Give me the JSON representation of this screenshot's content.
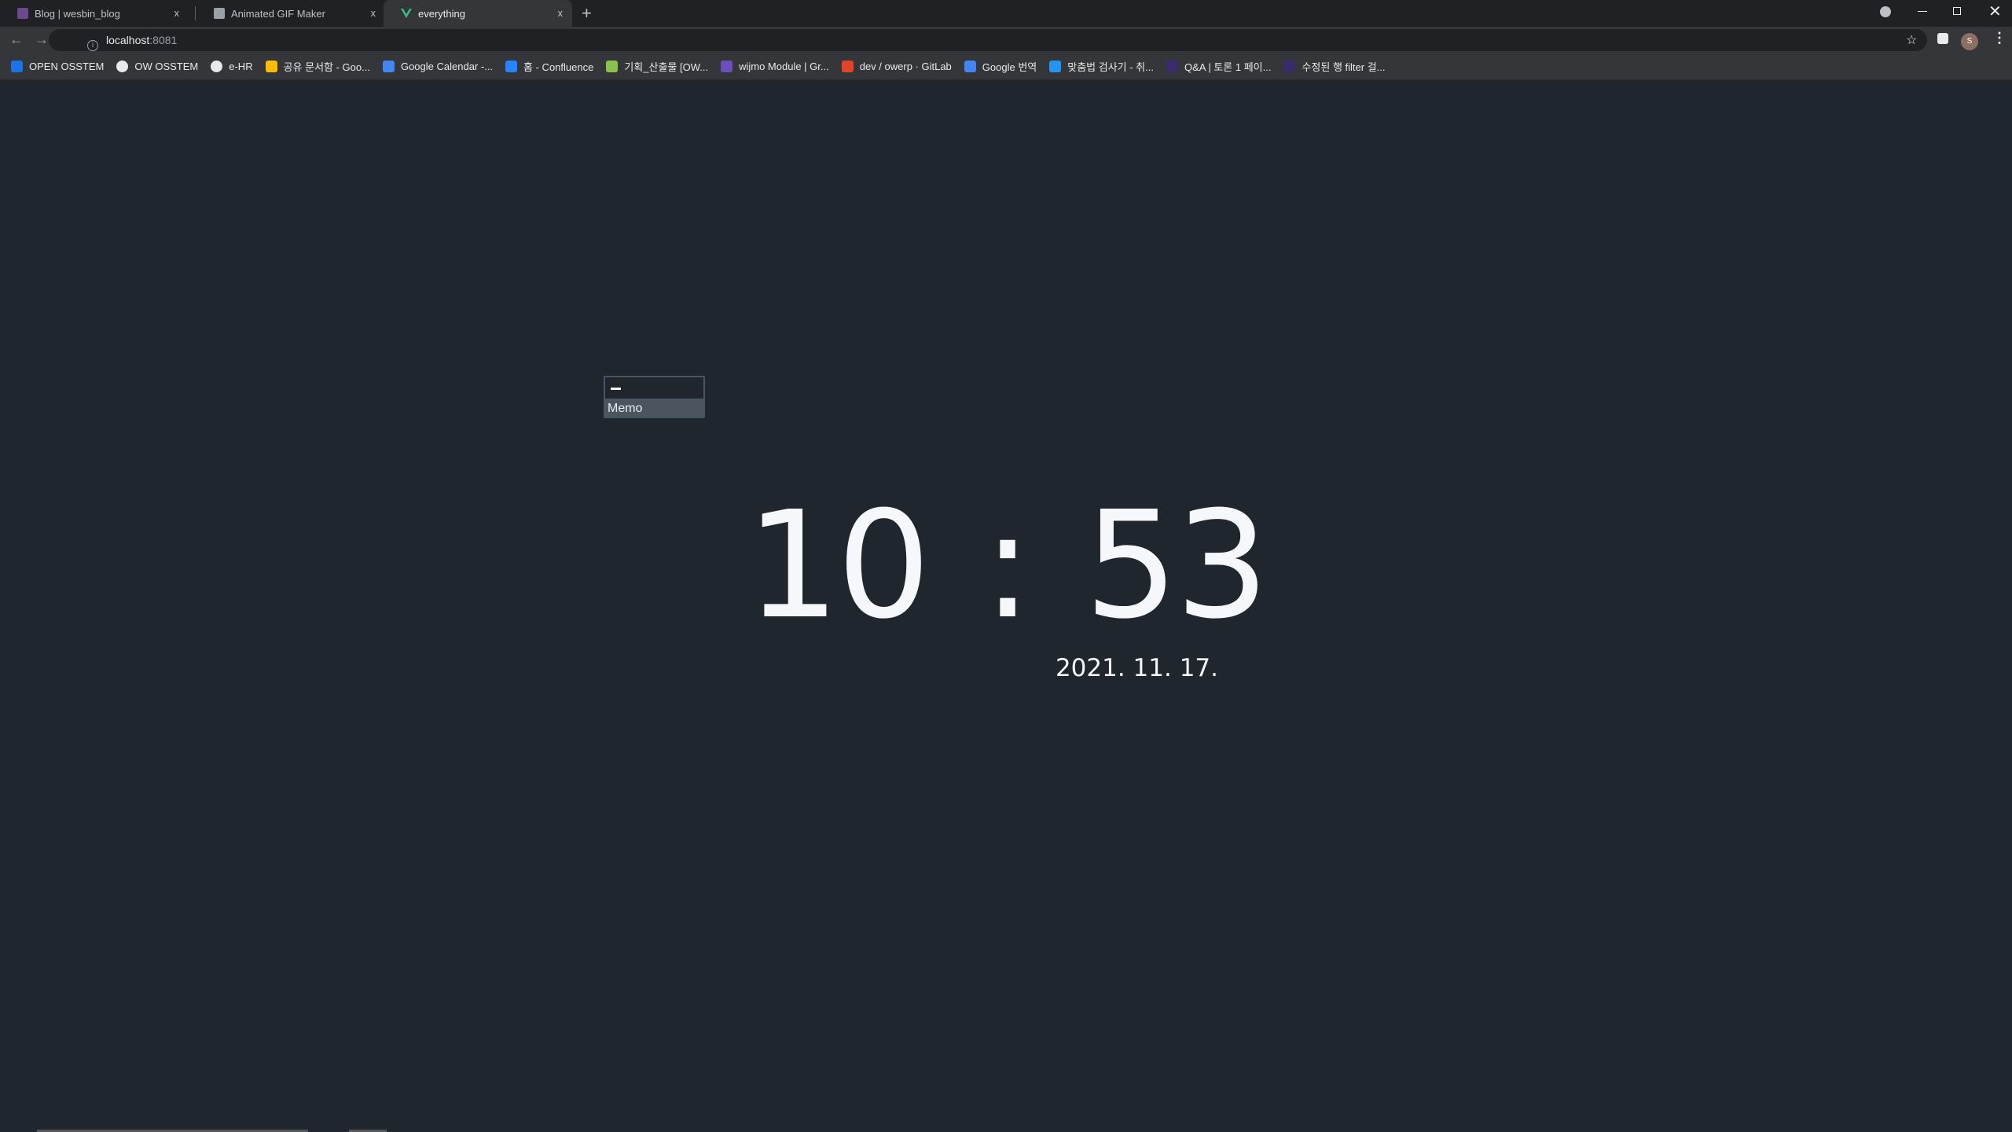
{
  "browser": {
    "tabs": [
      {
        "label": "Blog | wesbin_blog",
        "icon": "blog-favicon",
        "active": false
      },
      {
        "label": "Animated GIF Maker",
        "icon": "gif-favicon",
        "active": false
      },
      {
        "label": "everything",
        "icon": "vue-favicon",
        "active": true
      }
    ],
    "close_glyph": "x",
    "new_tab_glyph": "+",
    "url_host": "localhost",
    "url_port": ":8081",
    "avatar_initial": "S",
    "bookmarks": [
      {
        "label": "OPEN OSSTEM",
        "color": "#1a73e8"
      },
      {
        "label": "OW OSSTEM",
        "color": "#e8eaed"
      },
      {
        "label": "e-HR",
        "color": "#e8eaed"
      },
      {
        "label": "공유 문서함 - Goo...",
        "color": "#fbbc04"
      },
      {
        "label": "Google Calendar -...",
        "color": "#4285f4"
      },
      {
        "label": "홈 - Confluence",
        "color": "#2684ff"
      },
      {
        "label": "기획_산출물 [OW...",
        "color": "#8bc34a"
      },
      {
        "label": "wijmo Module | Gr...",
        "color": "#6b4fbb"
      },
      {
        "label": "dev / owerp · GitLab",
        "color": "#e24329"
      },
      {
        "label": "Google 번역",
        "color": "#4285f4"
      },
      {
        "label": "맞춤법 검사기 - 취...",
        "color": "#2196f3"
      },
      {
        "label": "Q&A | 토론 1 페이...",
        "color": "#3c2a6e"
      },
      {
        "label": "수정된 행 filter 걸...",
        "color": "#3c2a6e"
      }
    ]
  },
  "memo": {
    "input_value": "",
    "option": "Memo"
  },
  "clock": {
    "hours": "10",
    "separator": ":",
    "minutes": "53",
    "date": "2021. 11. 17."
  }
}
